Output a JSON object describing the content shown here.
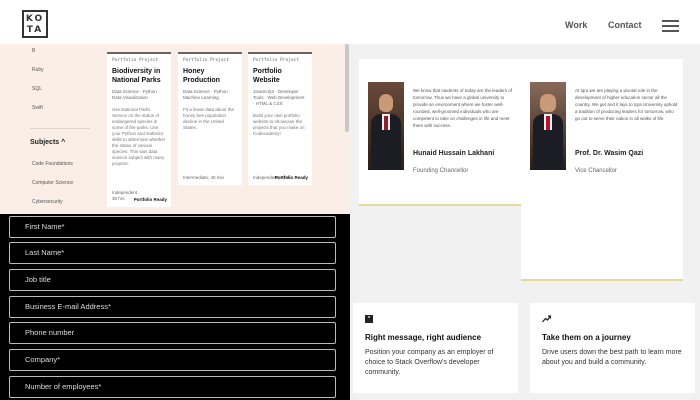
{
  "header": {
    "logo_lines": [
      "KO",
      "TA"
    ],
    "nav": [
      "Work",
      "Contact"
    ],
    "menu_icon": "hamburger-icon"
  },
  "filters": {
    "top_items": [
      "B",
      "Ruby",
      "SQL",
      "Swift"
    ],
    "subjects_heading": "Subjects ^",
    "subject_items": [
      "Code Foundations",
      "Computer Science",
      "Cybersecurity"
    ]
  },
  "portfolio": [
    {
      "type": "Portfolio Project",
      "title": "Biodiversity in National Parks",
      "tags": "Data Science · Python · Data Visualization",
      "desc": "Use National Parks Service on the status of endangered species in some of the parks. Use your Python and statistics skills to determine whether the status of various species. This was data science subject with many projects.",
      "footer": "Independent · 35 hrs",
      "badge": "Portfolio Ready"
    },
    {
      "type": "Portfolio Project",
      "title": "Honey Production",
      "tags": "Data Science · Python · Machine Learning",
      "desc": "Fit a linear data about the honey bee population decline in the United States.",
      "footer": "Intermediate, 40 min",
      "badge": ""
    },
    {
      "type": "Portfolio Project",
      "title": "Portfolio Website",
      "tags": "JavaScript · Developer Tools · Web Development · HTML & CSS",
      "desc": "Build your own portfolio website to showcase the projects that you make on Codecademy!",
      "footer": "Independent, 5 hrs",
      "badge": "Portfolio Ready"
    }
  ],
  "form_fields": [
    "First Name*",
    "Last Name*",
    "Job title",
    "Business E-mail Address*",
    "Phone number",
    "Company*",
    "Number of employees*"
  ],
  "chancellors": [
    {
      "bio": "We know that students of today are the leaders of tomorrow. Thus we have a global university to provide an environment where we foster well-rounded, well-groomed individuals who are competent to take on challenges in life and meet them with success.",
      "name": "Hunaid Hussain Lakhani",
      "title": "Founding Chancellor"
    },
    {
      "bio": "At Iqra we are playing a pivotal role in the development of higher education sector all the country. We get and it lays to Iqra University uphold a tradition of producing leaders for tomorrow, who go out to serve their nation in all walks of life.",
      "name": "Prof. Dr. Wasim Qazi",
      "title": "Vice Chancellor"
    }
  ],
  "features": [
    {
      "icon": "quote-icon",
      "title": "Right message, right audience",
      "text": "Position your company as an employer of choice to Stack Overflow's developer community."
    },
    {
      "icon": "trend-arrow-icon",
      "title": "Take them on a journey",
      "text": "Drive users down the best path to learn more about you and build a community."
    }
  ]
}
